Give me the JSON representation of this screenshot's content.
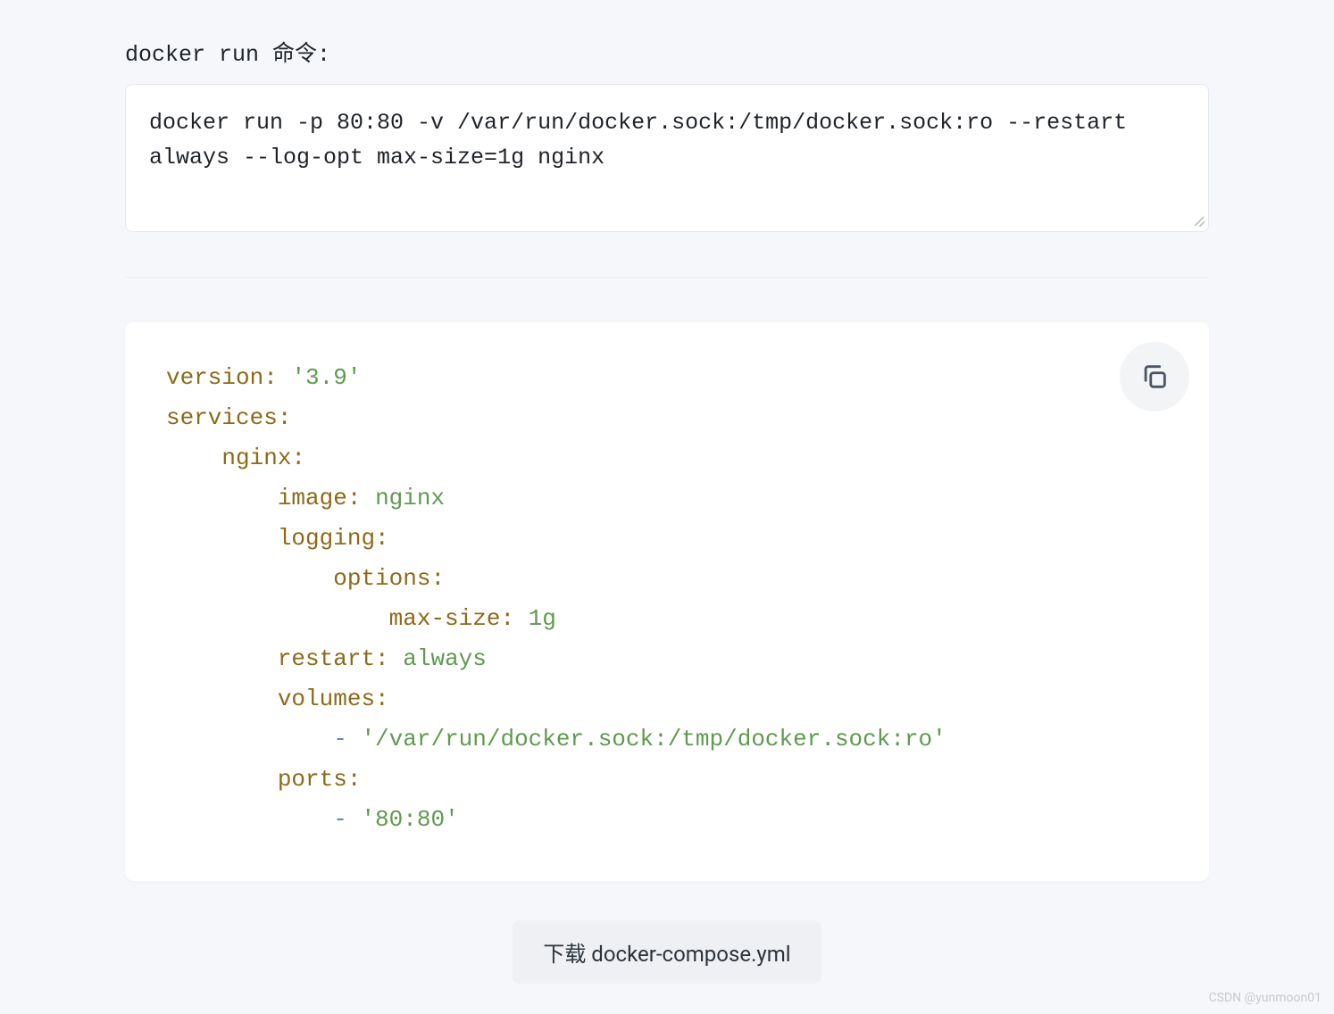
{
  "input": {
    "label": "docker run 命令:",
    "value": "docker run -p 80:80 -v /var/run/docker.sock:/tmp/docker.sock:ro --restart always --log-opt max-size=1g nginx"
  },
  "yaml": {
    "version_key": "version:",
    "version_val": "'3.9'",
    "services_key": "services:",
    "service_name_key": "nginx:",
    "image_key": "image:",
    "image_val": "nginx",
    "logging_key": "logging:",
    "options_key": "options:",
    "maxsize_key": "max-size:",
    "maxsize_val": "1g",
    "restart_key": "restart:",
    "restart_val": "always",
    "volumes_key": "volumes:",
    "volumes_item": "'/var/run/docker.sock:/tmp/docker.sock:ro'",
    "ports_key": "ports:",
    "ports_item": "'80:80'",
    "dash": "-"
  },
  "download_label": "下载 docker-compose.yml",
  "watermark": "CSDN @yunmoon01"
}
